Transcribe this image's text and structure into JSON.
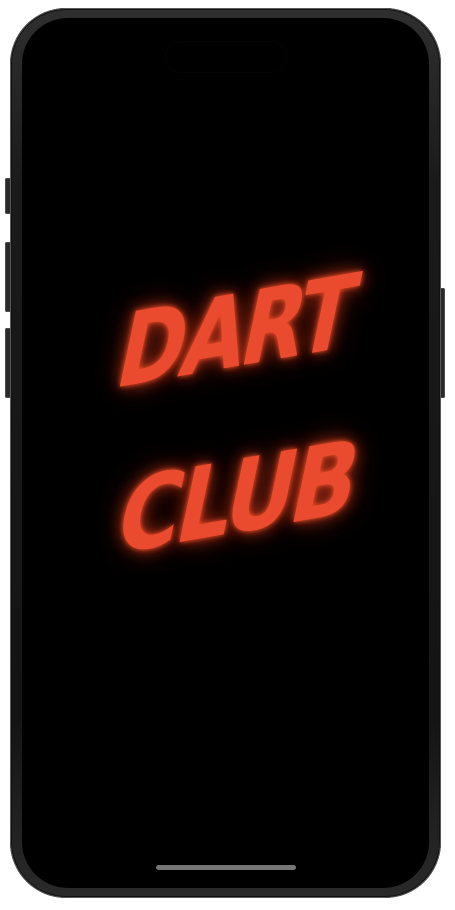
{
  "logo": {
    "line_1": "DART",
    "line_2": "CLUB",
    "color": "#ea4a2d"
  },
  "device": {
    "frame_color": "#1a1a1a",
    "screen_color": "#000000"
  }
}
